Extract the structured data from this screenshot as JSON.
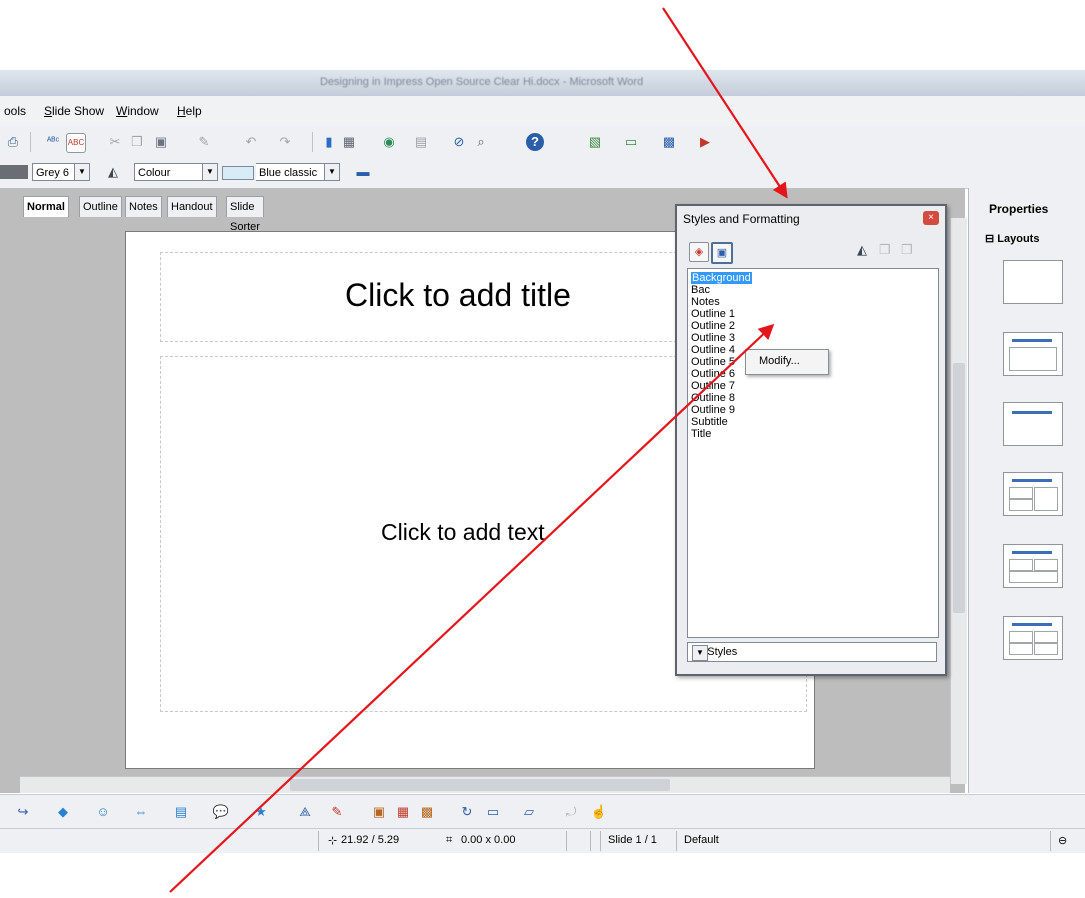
{
  "window": {
    "title": "Designing in Impress Open Source Clear Hi.docx - Microsoft Word"
  },
  "menubar": {
    "items": [
      "Tools",
      "Slide Show",
      "Window",
      "Help"
    ],
    "tools_visible": "ools"
  },
  "toolbar2": {
    "fill_color": "Grey 6",
    "area_style": "Colour",
    "gradient": "Blue classic"
  },
  "view_tabs": [
    "Normal",
    "Outline",
    "Notes",
    "Handout",
    "Slide Sorter"
  ],
  "slide": {
    "title_placeholder": "Click to add title",
    "body_placeholder": "Click to add text"
  },
  "styles_dialog": {
    "title": "Styles and Formatting",
    "close_icon": "×",
    "items": [
      "Background",
      "Bac",
      "Notes",
      "Outline 1",
      "Outline 2",
      "Outline 3",
      "Outline 4",
      "Outline 5",
      "Outline 6",
      "Outline 7",
      "Outline 8",
      "Outline 9",
      "Subtitle",
      "Title"
    ],
    "selected_item": "Background",
    "context_menu_item": "Modify...",
    "filter_value": "All Styles"
  },
  "properties_panel": {
    "title": "Properties",
    "section": "Layouts"
  },
  "statusbar": {
    "position": "21.92 / 5.29",
    "size": "0.00 x 0.00",
    "slide_info": "Slide 1 / 1",
    "master": "Default"
  },
  "annotation_color": "#e3161c"
}
